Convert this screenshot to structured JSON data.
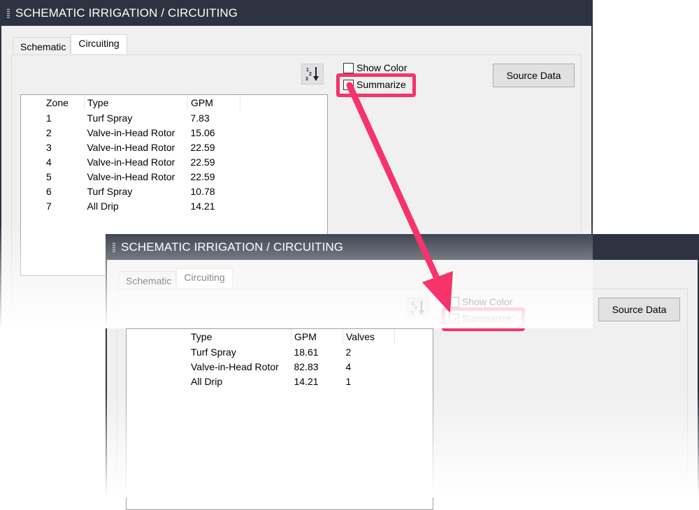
{
  "colors": {
    "titlebar_bg": "#2d3340",
    "panel_bg": "#f0f0f0",
    "highlight": "#f5346b"
  },
  "before": {
    "title": "SCHEMATIC IRRIGATION / CIRCUITING",
    "tabs": [
      {
        "label": "Schematic",
        "active": false
      },
      {
        "label": "Circuiting",
        "active": true
      }
    ],
    "sort_icon": "sort-numeric-descending-icon",
    "show_color": {
      "label": "Show Color",
      "checked": false
    },
    "summarize": {
      "label": "Summarize",
      "checked": false
    },
    "source_data_label": "Source Data",
    "table": {
      "columns": [
        "Zone",
        "Type",
        "GPM"
      ],
      "rows": [
        [
          "1",
          "Turf Spray",
          "7.83"
        ],
        [
          "2",
          "Valve-in-Head Rotor",
          "15.06"
        ],
        [
          "3",
          "Valve-in-Head Rotor",
          "22.59"
        ],
        [
          "4",
          "Valve-in-Head Rotor",
          "22.59"
        ],
        [
          "5",
          "Valve-in-Head Rotor",
          "22.59"
        ],
        [
          "6",
          "Turf Spray",
          "10.78"
        ],
        [
          "7",
          "All Drip",
          "14.21"
        ]
      ]
    }
  },
  "after": {
    "title": "SCHEMATIC IRRIGATION / CIRCUITING",
    "tabs": [
      {
        "label": "Schematic",
        "active": false
      },
      {
        "label": "Circuiting",
        "active": true
      }
    ],
    "sort_icon": "sort-numeric-descending-icon",
    "show_color": {
      "label": "Show Color",
      "checked": false
    },
    "summarize": {
      "label": "Summarize",
      "checked": true
    },
    "source_data_label": "Source Data",
    "table": {
      "columns": [
        "Type",
        "GPM",
        "Valves"
      ],
      "rows": [
        [
          "Turf Spray",
          "18.61",
          "2"
        ],
        [
          "Valve-in-Head Rotor",
          "82.83",
          "4"
        ],
        [
          "All Drip",
          "14.21",
          "1"
        ]
      ]
    }
  }
}
